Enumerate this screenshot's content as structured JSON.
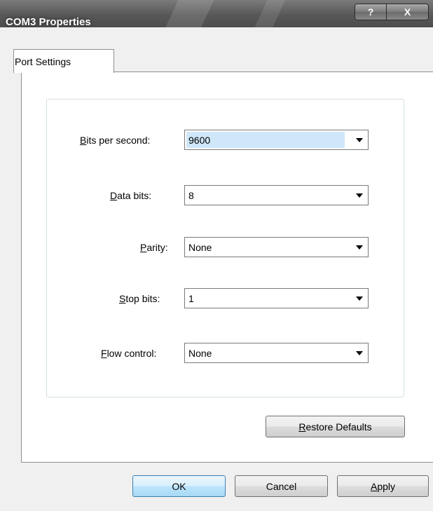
{
  "window": {
    "title": "COM3 Properties",
    "help_glyph": "?",
    "close_glyph": "X"
  },
  "tabs": [
    {
      "label": "Port Settings",
      "selected": true
    }
  ],
  "fields": [
    {
      "label_pre": "",
      "label_accel": "B",
      "label_post": "its per second:",
      "value": "9600",
      "selected": true
    },
    {
      "label_pre": "",
      "label_accel": "D",
      "label_post": "ata bits:",
      "value": "8",
      "selected": false
    },
    {
      "label_pre": "",
      "label_accel": "P",
      "label_post": "arity:",
      "value": "None",
      "selected": false
    },
    {
      "label_pre": "",
      "label_accel": "S",
      "label_post": "top bits:",
      "value": "1",
      "selected": false
    },
    {
      "label_pre": "",
      "label_accel": "F",
      "label_post": "low control:",
      "value": "None",
      "selected": false
    }
  ],
  "restore_button": {
    "accel": "R",
    "rest": "estore Defaults"
  },
  "buttons": {
    "ok": "OK",
    "cancel": "Cancel",
    "apply_accel": "A",
    "apply_rest": "pply"
  },
  "icons": {
    "dropdown": "chevron-down-icon",
    "help": "help-icon",
    "close": "close-icon"
  },
  "colors": {
    "titlebar": "#5f5f5f",
    "selection": "#cfe7f8",
    "default_button_border": "#3c7fb1"
  }
}
